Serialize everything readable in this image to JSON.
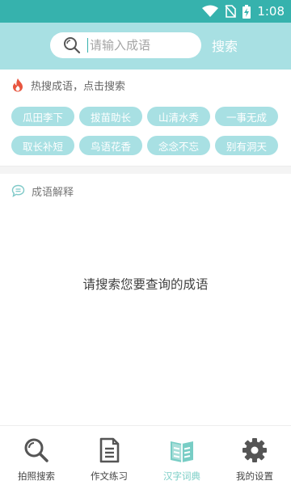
{
  "status_bar": {
    "time": "1:08",
    "icons": [
      "wifi-icon",
      "no-sim-icon",
      "battery-charging-icon"
    ]
  },
  "search": {
    "placeholder": "请输入成语",
    "button_label": "搜索"
  },
  "hot": {
    "icon": "flame-icon",
    "title": "热搜成语，点击搜索",
    "tags": [
      "瓜田李下",
      "拔苗助长",
      "山清水秀",
      "一事无成",
      "取长补短",
      "鸟语花香",
      "念念不忘",
      "别有洞天"
    ]
  },
  "explain": {
    "icon": "chat-bubble-icon",
    "title": "成语解释"
  },
  "empty_message": "请搜索您要查询的成语",
  "nav": [
    {
      "label": "拍照搜索",
      "icon": "search-icon",
      "active": false
    },
    {
      "label": "作文练习",
      "icon": "document-icon",
      "active": false
    },
    {
      "label": "汉字词典",
      "icon": "book-icon",
      "active": true
    },
    {
      "label": "我的设置",
      "icon": "gear-icon",
      "active": false
    }
  ],
  "colors": {
    "accent": "#36b2ad",
    "light": "#a8e0e3",
    "active_tab": "#78cdc5",
    "flame": "#e8553f"
  }
}
